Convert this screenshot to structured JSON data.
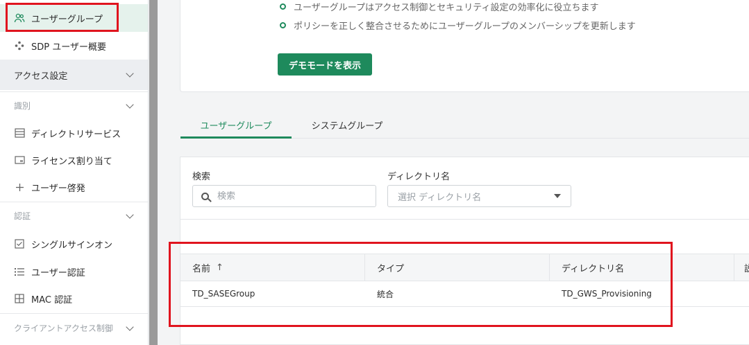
{
  "sidebar": {
    "items": [
      {
        "label": "ユーザーグループ",
        "icon": "users-icon",
        "active": true
      },
      {
        "label": "SDP ユーザー概要",
        "icon": "grid-dots-icon"
      }
    ],
    "access_section": "アクセス設定",
    "identity_section": "識別",
    "identity_items": [
      {
        "label": "ディレクトリサービス",
        "icon": "list-lines-icon"
      },
      {
        "label": "ライセンス割り当て",
        "icon": "license-icon"
      },
      {
        "label": "ユーザー啓発",
        "icon": "plus-icon"
      }
    ],
    "auth_section": "認証",
    "auth_items": [
      {
        "label": "シングルサインオン",
        "icon": "checkbox-icon"
      },
      {
        "label": "ユーザー認証",
        "icon": "bullet-list-icon"
      },
      {
        "label": "MAC 認証",
        "icon": "grid-icon"
      }
    ],
    "client_section": "クライアントアクセス制御"
  },
  "info": {
    "bullets": [
      "ユーザーグループはアクセス制御とセキュリティ設定の効率化に役立ちます",
      "ポリシーを正しく整合させるためにユーザーグループのメンバーシップを更新します"
    ],
    "demo_button": "デモモードを表示"
  },
  "tabs": [
    {
      "label": "ユーザーグループ",
      "active": true
    },
    {
      "label": "システムグループ",
      "active": false
    }
  ],
  "filters": {
    "search_label": "検索",
    "search_placeholder": "検索",
    "directory_label": "ディレクトリ名",
    "directory_placeholder": "選択 ディレクトリ名"
  },
  "table": {
    "columns": [
      "名前",
      "タイプ",
      "ディレクトリ名",
      "説"
    ],
    "sort_indicator": "↑",
    "rows": [
      [
        "TD_SASEGroup",
        "統合",
        "TD_GWS_Provisioning"
      ]
    ]
  },
  "colors": {
    "accent": "#1e8a5c",
    "highlight": "#e0141e"
  }
}
